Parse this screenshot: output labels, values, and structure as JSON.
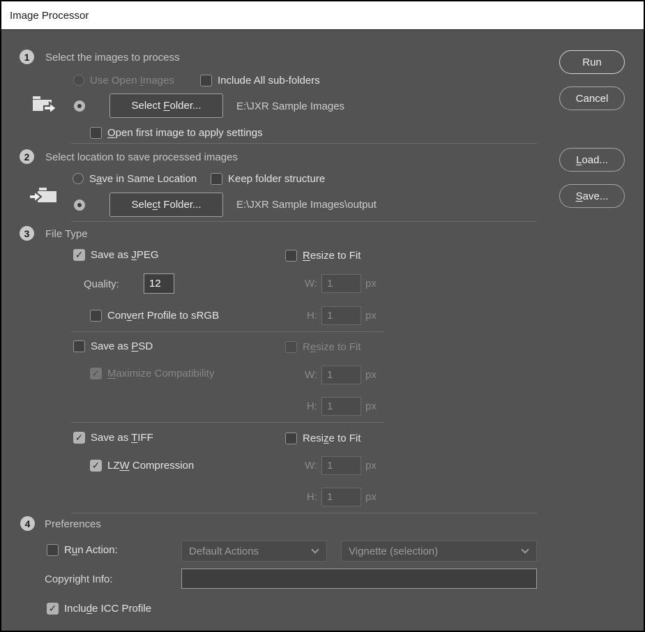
{
  "title": "Image Processor",
  "colors": {
    "dialog_bg": "#535353",
    "titlebar_bg": "#ffffff",
    "text": "#e4e4e4",
    "disabled_text": "#878787"
  },
  "buttons": {
    "run": "Run",
    "cancel": "Cancel",
    "load": {
      "pre": "",
      "key": "L",
      "post": "oad..."
    },
    "save": {
      "pre": "",
      "key": "S",
      "post": "ave..."
    }
  },
  "section1": {
    "number": "1",
    "header": "Select the images to process",
    "use_open_images": {
      "pre": "Use Open ",
      "key": "I",
      "post": "mages"
    },
    "include_subfolders": "Include All sub-folders",
    "select_folder": {
      "pre": "Select ",
      "key": "F",
      "post": "older..."
    },
    "folder_path": "E:\\JXR Sample Images",
    "open_first": {
      "pre": "",
      "key": "O",
      "post": "pen first image to apply settings"
    }
  },
  "section2": {
    "number": "2",
    "header": "Select location to save processed images",
    "save_same": {
      "pre": "S",
      "key": "a",
      "post": "ve in Same Location"
    },
    "keep_structure": "Keep folder structure",
    "select_folder": {
      "pre": "Sele",
      "key": "c",
      "post": "t Folder..."
    },
    "folder_path": "E:\\JXR Sample Images\\output"
  },
  "section3": {
    "number": "3",
    "header": "File Type",
    "common": {
      "w": "W:",
      "h": "H:",
      "px": "px",
      "value": "1"
    },
    "jpeg": {
      "save": {
        "pre": "Save as ",
        "key": "J",
        "post": "PEG"
      },
      "resize": {
        "pre": "",
        "key": "R",
        "post": "esize to Fit"
      },
      "quality_label": "Quality:",
      "quality_value": "12",
      "convert": {
        "pre": "Con",
        "key": "v",
        "post": "ert Profile to sRGB"
      }
    },
    "psd": {
      "save": {
        "pre": "Save as ",
        "key": "P",
        "post": "SD"
      },
      "resize": {
        "pre": "R",
        "key": "e",
        "post": "size to Fit"
      },
      "maximize": {
        "pre": "",
        "key": "M",
        "post": "aximize Compatibility"
      }
    },
    "tiff": {
      "save": {
        "pre": "Save as ",
        "key": "T",
        "post": "IFF"
      },
      "resize": {
        "pre": "Resi",
        "key": "z",
        "post": "e to Fit"
      },
      "lzw": {
        "pre": "LZ",
        "key": "W",
        "post": " Compression"
      }
    }
  },
  "section4": {
    "number": "4",
    "header": "Preferences",
    "run_action": {
      "pre": "R",
      "key": "u",
      "post": "n Action:"
    },
    "action_set": "Default Actions",
    "action_name": "Vignette (selection)",
    "copyright_label": "Copyright Info:",
    "copyright_value": "",
    "include_icc": {
      "pre": "Inclu",
      "key": "d",
      "post": "e ICC Profile"
    }
  }
}
